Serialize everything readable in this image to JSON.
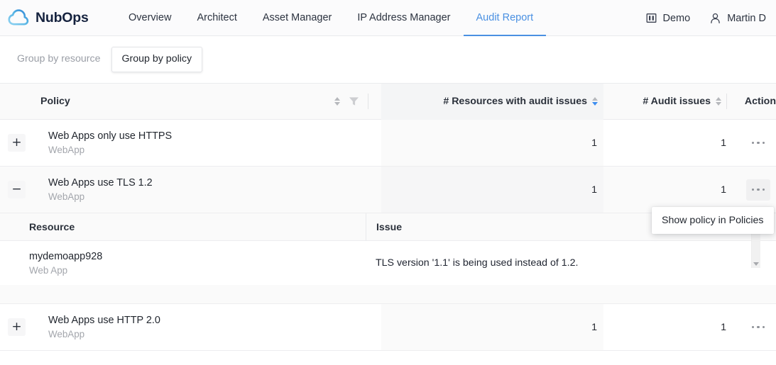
{
  "brand": {
    "name": "NubOps",
    "logo_icon": "cloud-icon",
    "logo_color": "#5bb9e8"
  },
  "nav": {
    "items": [
      {
        "label": "Overview",
        "active": false
      },
      {
        "label": "Architect",
        "active": false
      },
      {
        "label": "Asset Manager",
        "active": false
      },
      {
        "label": "IP Address Manager",
        "active": false
      },
      {
        "label": "Audit Report",
        "active": true
      }
    ],
    "accent_color": "#4a90e2",
    "right": {
      "org": {
        "label": "Demo",
        "icon": "building-icon"
      },
      "user": {
        "label": "Martin D",
        "icon": "person-icon"
      }
    }
  },
  "toolbar": {
    "group_by_resource": "Group by resource",
    "group_by_policy": "Group by policy",
    "active": "Group by policy"
  },
  "table": {
    "columns": {
      "policy": "Policy",
      "resources_with_issues": "# Resources with audit issues",
      "audit_issues": "# Audit issues",
      "action": "Action"
    },
    "sort": {
      "column": "# Resources with audit issues",
      "direction": "desc",
      "active_color": "#3d8ef0"
    },
    "filter_icon": "funnel-icon",
    "rows": [
      {
        "expander": "+",
        "expanded": false,
        "title": "Web Apps only use HTTPS",
        "subtitle": "WebApp",
        "resources_with_issues": "1",
        "audit_issues": "1"
      },
      {
        "expander": "−",
        "expanded": true,
        "title": "Web Apps use TLS 1.2",
        "subtitle": "WebApp",
        "resources_with_issues": "1",
        "audit_issues": "1"
      },
      {
        "expander": "+",
        "expanded": false,
        "title": "Web Apps use HTTP 2.0",
        "subtitle": "WebApp",
        "resources_with_issues": "1",
        "audit_issues": "1"
      }
    ]
  },
  "subtable": {
    "columns": {
      "resource": "Resource",
      "issue": "Issue"
    },
    "rows": [
      {
        "resource": "mydemoapp928",
        "resource_type": "Web App",
        "issue": "TLS version '1.1' is being used instead of 1.2."
      }
    ],
    "scrollbar": {
      "up_icon": "caret-up-icon",
      "down_icon": "caret-down-icon"
    }
  },
  "popup": {
    "items": [
      {
        "label": "Show policy in Policies"
      }
    ]
  }
}
